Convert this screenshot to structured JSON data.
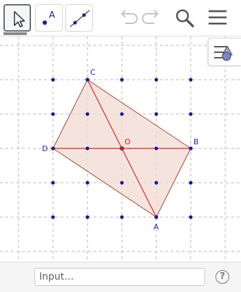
{
  "toolbar": {
    "tools": [
      {
        "icon": "move-tool-icon",
        "selected": true
      },
      {
        "icon": "point-tool-icon",
        "label": "A"
      },
      {
        "icon": "line-tool-icon"
      }
    ],
    "actions": [
      "undo-icon",
      "redo-icon",
      "search-icon",
      "menu-icon"
    ]
  },
  "graphics": {
    "points": [
      {
        "name": "C",
        "color": "#1e1ea8"
      },
      {
        "name": "D",
        "color": "#1e1ea8"
      },
      {
        "name": "O",
        "color": "#cc2222"
      },
      {
        "name": "B",
        "color": "#1e1ea8"
      },
      {
        "name": "A",
        "color": "#1e1ea8"
      }
    ],
    "polygon_fill": "#f3ddd5",
    "polygon_edge": "#9a4a2a",
    "diagonal_color": "#e02020",
    "grid_point_color": "#1414a8"
  },
  "input_bar": {
    "placeholder": "Input…",
    "help_label": "?"
  }
}
